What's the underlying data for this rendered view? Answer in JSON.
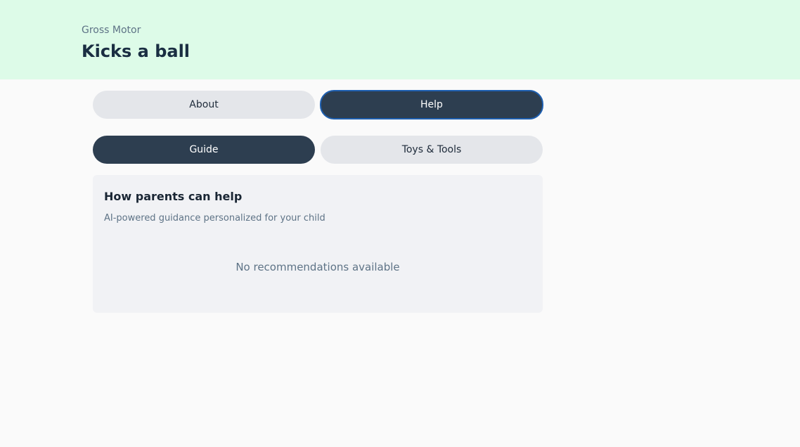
{
  "header": {
    "category": "Gross Motor",
    "title": "Kicks a ball",
    "background_color": "#ddfbe8"
  },
  "primary_tabs": [
    {
      "label": "About",
      "active": false
    },
    {
      "label": "Help",
      "active": true
    }
  ],
  "secondary_tabs": [
    {
      "label": "Guide",
      "active": true
    },
    {
      "label": "Toys & Tools",
      "active": false
    }
  ],
  "guide_card": {
    "title": "How parents can help",
    "subtitle": "AI-powered guidance personalized for your child",
    "empty_message": "No recommendations available"
  },
  "colors": {
    "active_tab": "#2d3e50",
    "inactive_tab": "#e4e6ea",
    "focus_ring": "#1e5fb0"
  }
}
